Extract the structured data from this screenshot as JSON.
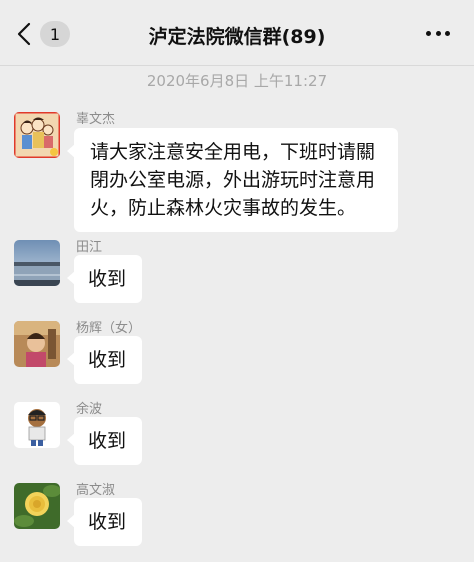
{
  "header": {
    "back_badge": "1",
    "title": "泸定法院微信群(89)"
  },
  "timestamp": "2020年6月8日 上午11:27",
  "messages": [
    {
      "sender": "辜文杰",
      "text": "请大家注意安全用电，下班时请關閉办公室电源，外出游玩时注意用火，防止森林火灾事故的发生。",
      "avatar_icon": "cartoon-family-avatar"
    },
    {
      "sender": "田江",
      "text": "收到",
      "avatar_icon": "lake-landscape-avatar"
    },
    {
      "sender": "杨辉（女）",
      "text": "收到",
      "avatar_icon": "person-photo-avatar"
    },
    {
      "sender": "余波",
      "text": "收到",
      "avatar_icon": "cartoon-man-avatar"
    },
    {
      "sender": "高文淑",
      "text": "收到",
      "avatar_icon": "yellow-rose-avatar"
    }
  ],
  "colors": {
    "background": "#ededed",
    "bubble": "#ffffff",
    "sender_text": "#8c8c8c",
    "timestamp_text": "#a8a8a8"
  }
}
